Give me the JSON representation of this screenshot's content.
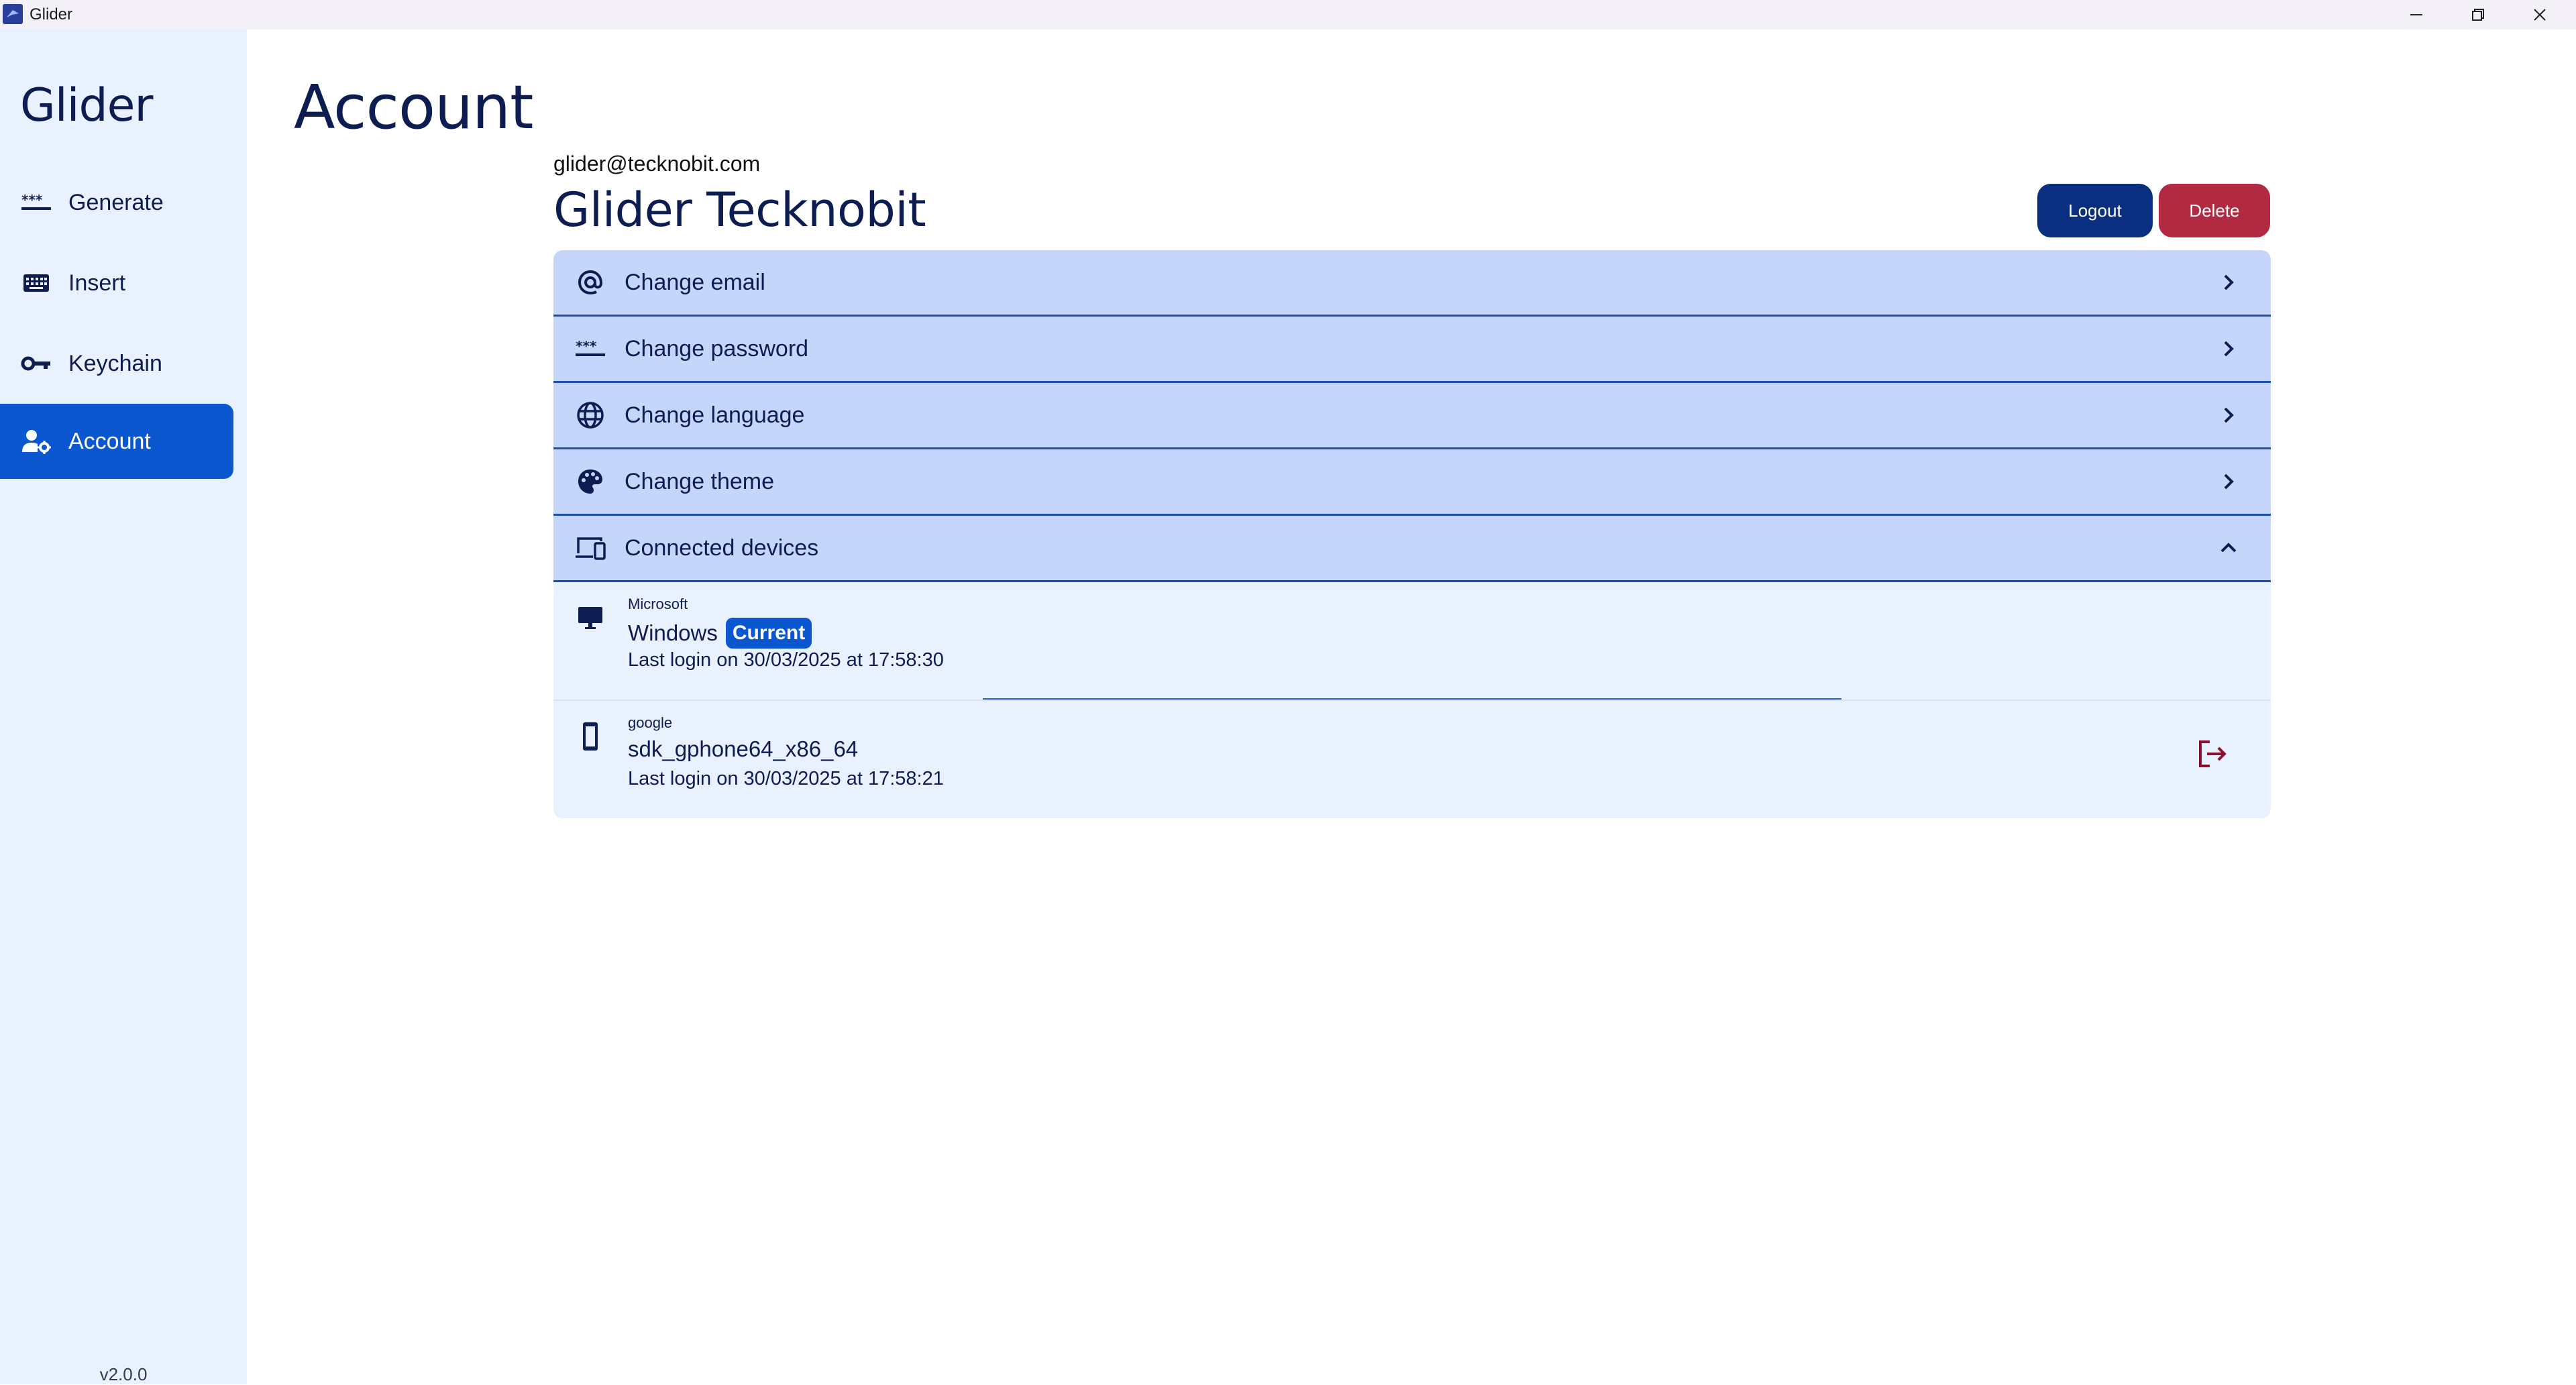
{
  "window": {
    "title": "Glider"
  },
  "sidebar": {
    "brand": "Glider",
    "items": [
      {
        "label": "Generate",
        "icon": "password-dots-icon"
      },
      {
        "label": "Insert",
        "icon": "keyboard-icon"
      },
      {
        "label": "Keychain",
        "icon": "key-icon"
      },
      {
        "label": "Account",
        "icon": "manage-account-icon",
        "active": true
      }
    ],
    "version": "v2.0.0"
  },
  "main": {
    "title": "Account",
    "user": {
      "email": "glider@tecknobit.com",
      "name": "Glider Tecknobit"
    },
    "buttons": {
      "logout": "Logout",
      "delete": "Delete"
    },
    "settings": [
      {
        "label": "Change email",
        "icon": "at-sign-icon"
      },
      {
        "label": "Change password",
        "icon": "password-dots-icon"
      },
      {
        "label": "Change language",
        "icon": "globe-icon"
      },
      {
        "label": "Change theme",
        "icon": "palette-icon"
      },
      {
        "label": "Connected devices",
        "icon": "devices-icon",
        "expanded": true
      }
    ],
    "devices": [
      {
        "vendor": "Microsoft",
        "name": "Windows",
        "badge": "Current",
        "login": "Last login on 30/03/2025 at 17:58:30",
        "icon": "desktop-icon"
      },
      {
        "vendor": "google",
        "name": "sdk_gphone64_x86_64",
        "login": "Last login on 30/03/2025 at 17:58:21",
        "icon": "phone-icon"
      }
    ]
  },
  "colors": {
    "accent": "#0a57d0",
    "brand_dark": "#0d1d52",
    "row_bg": "#c6d6fa",
    "sidebar_bg": "#eaf1fe",
    "logout": "#0a2f80",
    "delete": "#b22a42",
    "logout_icon": "#8a1030"
  }
}
